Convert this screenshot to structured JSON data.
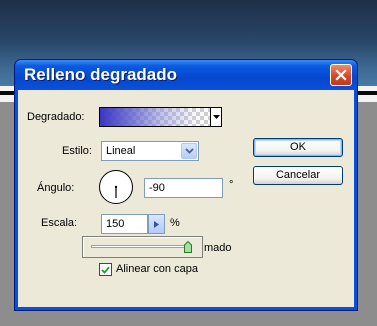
{
  "dialog": {
    "title": "Relleno degradado",
    "close_icon": "close-x-icon"
  },
  "fields": {
    "gradient_label": "Degradado:",
    "style_label": "Estilo:",
    "style_value": "Lineal",
    "angle_label": "Ángulo:",
    "angle_value": "-90",
    "angle_unit": "°",
    "scale_label": "Escala:",
    "scale_value": "150",
    "scale_unit": "%",
    "partial_label": "mado",
    "align_label": "Alinear con capa",
    "align_checked": true
  },
  "buttons": {
    "ok": "OK",
    "cancel": "Cancelar"
  },
  "slider": {
    "level": 0.97
  },
  "colors": {
    "titlebar": "#0a50d6",
    "close": "#d8472a",
    "gradient_start": "#3a36c4",
    "dialog_face": "#ece9d8"
  }
}
